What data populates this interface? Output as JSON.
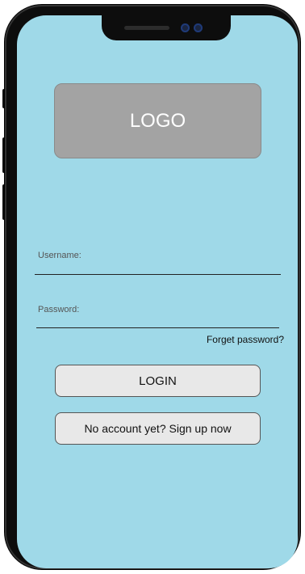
{
  "logo": {
    "text": "LOGO"
  },
  "form": {
    "username_label": "Username:",
    "username_value": "",
    "password_label": "Password:",
    "password_value": "",
    "forgot_link": "Forget password?"
  },
  "buttons": {
    "login": "LOGIN",
    "signup": "No account yet? Sign up now"
  },
  "colors": {
    "screen_background": "#9fd9e8",
    "logo_background": "#a3a3a3",
    "button_background": "#e8e8e8",
    "device_frame": "#0d0d0d"
  }
}
